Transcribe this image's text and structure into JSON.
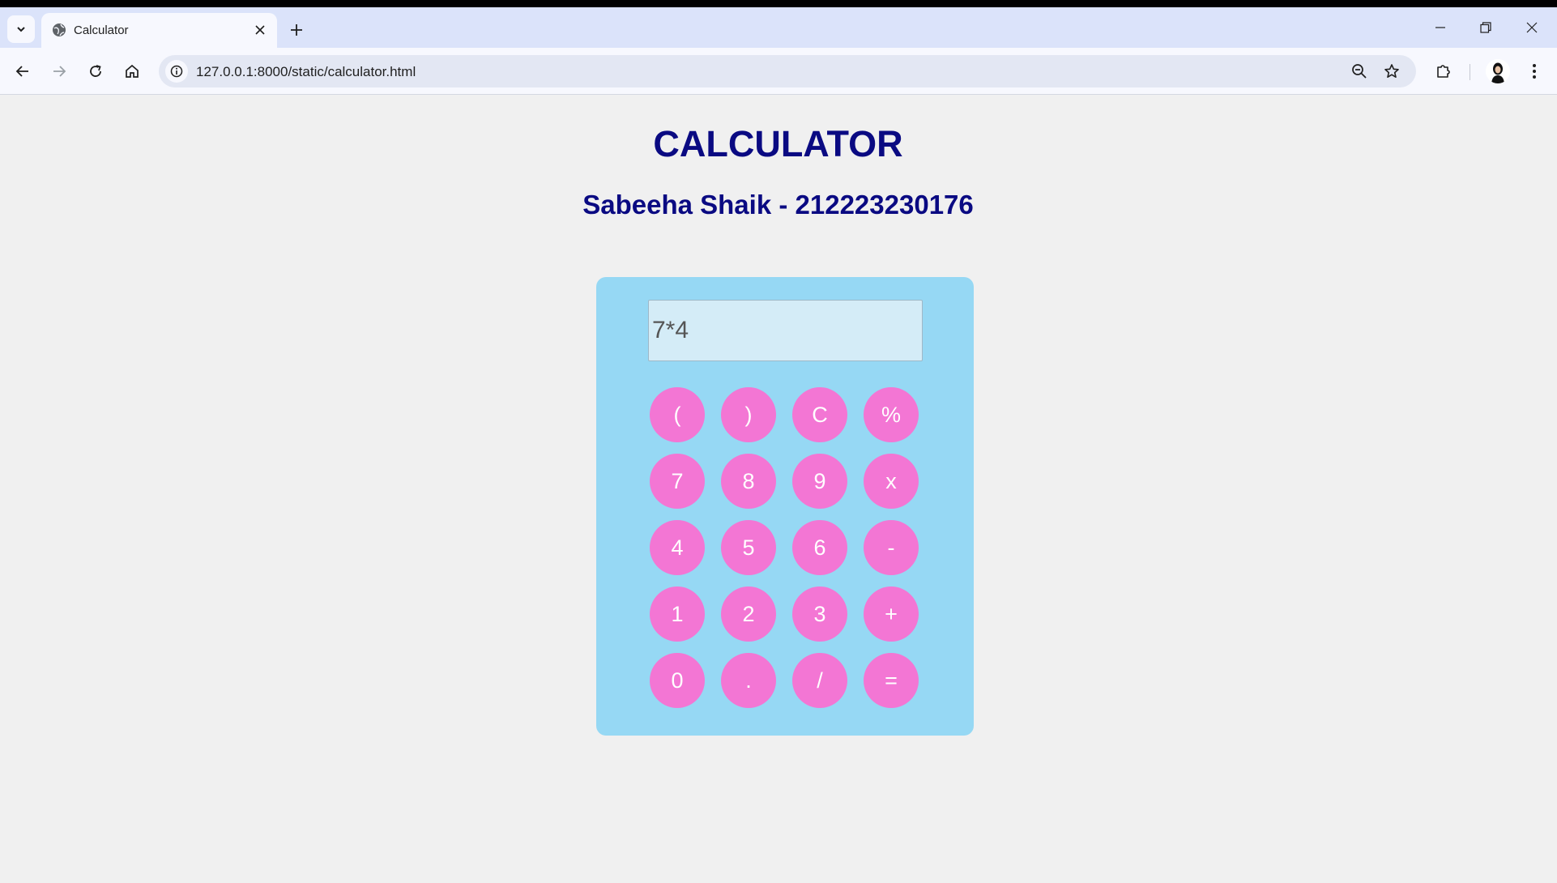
{
  "browser": {
    "tab_title": "Calculator",
    "url": "127.0.0.1:8000/static/calculator.html"
  },
  "icons": {
    "tab_search": "chevron-down-icon",
    "favicon": "globe-icon",
    "tab_close": "close-icon",
    "new_tab": "plus-icon",
    "minimize": "minimize-icon",
    "restore": "restore-icon",
    "close_window": "close-icon",
    "back": "arrow-left-icon",
    "forward": "arrow-right-icon",
    "reload": "reload-icon",
    "home": "home-icon",
    "site_info": "info-icon",
    "zoom": "zoom-out-icon",
    "bookmark": "star-icon",
    "extensions": "puzzle-icon",
    "menu": "kebab-menu-icon"
  },
  "page": {
    "title": "CALCULATOR",
    "subtitle": "Sabeeha Shaik - 212223230176"
  },
  "calculator": {
    "display_value": "7*4",
    "keys": [
      "(",
      ")",
      "C",
      "%",
      "7",
      "8",
      "9",
      "x",
      "4",
      "5",
      "6",
      "-",
      "1",
      "2",
      "3",
      "+",
      "0",
      ".",
      "/",
      "="
    ]
  },
  "colors": {
    "heading": "#0a0a82",
    "calculator_body": "#96d8f4",
    "display_bg": "#d4ecf7",
    "key_bg": "#f376d4",
    "key_text": "#ffffff",
    "page_bg": "#f0f0f0"
  }
}
